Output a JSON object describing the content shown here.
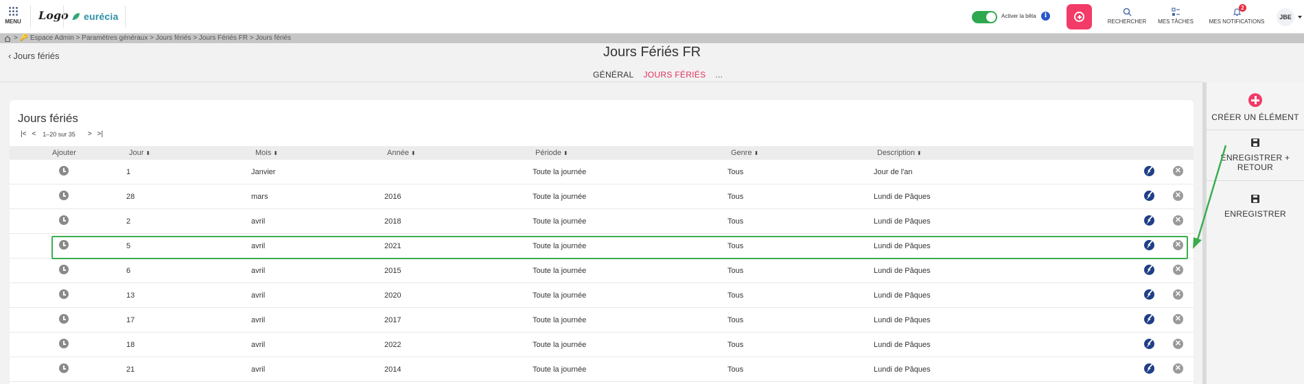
{
  "topbar": {
    "menu_label": "MENU",
    "logo_text": "Logo",
    "brand_name": "eurécia",
    "beta_label": "Activer la bêta",
    "info_glyph": "i",
    "add_icon": "plus-circle-icon",
    "tools": [
      {
        "icon": "search-icon",
        "label": "RECHERCHER"
      },
      {
        "icon": "tasks-icon",
        "label": "MES TÂCHES"
      },
      {
        "icon": "bell-icon",
        "label": "MES NOTIFICATIONS",
        "badge": "2"
      }
    ],
    "user_initials": "JBE"
  },
  "breadcrumb": {
    "text": "> 🔑 Espace Admin > Paramètres généraux > Jours fériés > Jours Fériés FR > Jours fériés"
  },
  "header": {
    "back_label": "Jours fériés",
    "title": "Jours Fériés FR",
    "tabs": [
      {
        "label": "GÉNÉRAL",
        "active": false
      },
      {
        "label": "JOURS FÉRIÉS",
        "active": true
      },
      {
        "label": "...",
        "active": false
      }
    ]
  },
  "card": {
    "title": "Jours fériés",
    "pager": {
      "first": "|<",
      "prev": "<",
      "info": "1–20 sur 35",
      "next": ">",
      "last": ">|"
    }
  },
  "table": {
    "columns": [
      "Ajouter",
      "Jour",
      "Mois",
      "Année",
      "Période",
      "Genre",
      "Description"
    ],
    "sort_glyph": "⬍",
    "rows": [
      {
        "jour": "1",
        "mois": "Janvier",
        "annee": "",
        "periode": "Toute la journée",
        "genre": "Tous",
        "description": "Jour de l'an"
      },
      {
        "jour": "28",
        "mois": "mars",
        "annee": "2016",
        "periode": "Toute la journée",
        "genre": "Tous",
        "description": "Lundi de Pâques"
      },
      {
        "jour": "2",
        "mois": "avril",
        "annee": "2018",
        "periode": "Toute la journée",
        "genre": "Tous",
        "description": "Lundi de Pâques"
      },
      {
        "jour": "5",
        "mois": "avril",
        "annee": "2021",
        "periode": "Toute la journée",
        "genre": "Tous",
        "description": "Lundi de Pâques"
      },
      {
        "jour": "6",
        "mois": "avril",
        "annee": "2015",
        "periode": "Toute la journée",
        "genre": "Tous",
        "description": "Lundi de Pâques"
      },
      {
        "jour": "13",
        "mois": "avril",
        "annee": "2020",
        "periode": "Toute la journée",
        "genre": "Tous",
        "description": "Lundi de Pâques"
      },
      {
        "jour": "17",
        "mois": "avril",
        "annee": "2017",
        "periode": "Toute la journée",
        "genre": "Tous",
        "description": "Lundi de Pâques"
      },
      {
        "jour": "18",
        "mois": "avril",
        "annee": "2022",
        "periode": "Toute la journée",
        "genre": "Tous",
        "description": "Lundi de Pâques"
      },
      {
        "jour": "21",
        "mois": "avril",
        "annee": "2014",
        "periode": "Toute la journée",
        "genre": "Tous",
        "description": "Lundi de Pâques"
      }
    ],
    "delete_glyph": "✕"
  },
  "side_panel": {
    "create_label": "CRÉER UN ÉLÉMENT",
    "save_return_label": "ENREGISTRER + RETOUR",
    "save_label": "ENREGISTRER"
  },
  "colors": {
    "accent": "#f23b67",
    "highlight": "#3aac4d",
    "toggle_on": "#2fa84f",
    "brand": "#2b8fa8"
  }
}
